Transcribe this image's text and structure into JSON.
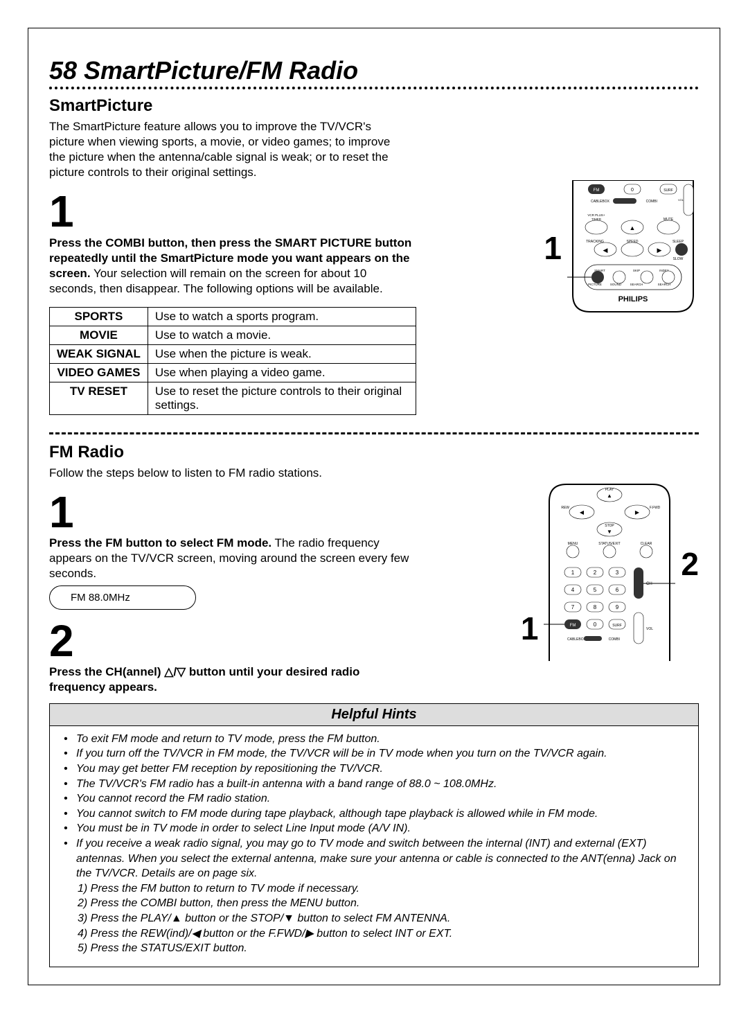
{
  "page_number": "58",
  "page_title": "SmartPicture/FM Radio",
  "smartpicture": {
    "heading": "SmartPicture",
    "intro": "The SmartPicture feature allows you to improve the TV/VCR's picture when viewing sports, a movie, or video games; to improve the picture when the antenna/cable signal is weak; or to reset the picture controls to their original settings.",
    "step1_num": "1",
    "step1_bold": "Press the COMBI button, then press the SMART PICTURE button repeatedly until the SmartPicture mode you want appears on the screen.",
    "step1_rest": " Your selection will remain on the screen for about 10 seconds, then disappear. The following options will be available.",
    "modes": [
      {
        "label": "SPORTS",
        "desc": "Use to watch a sports program."
      },
      {
        "label": "MOVIE",
        "desc": "Use to watch a movie."
      },
      {
        "label": "WEAK SIGNAL",
        "desc": "Use when the picture is weak."
      },
      {
        "label": "VIDEO GAMES",
        "desc": "Use when playing a video game."
      },
      {
        "label": "TV RESET",
        "desc": "Use to reset the picture controls to their original settings."
      }
    ],
    "callout1": "1",
    "remote_brand": "PHILIPS",
    "remote_buttons": {
      "fm": "FM",
      "zero": "0",
      "surf": "SURF",
      "cablebox": "CABLEBOX",
      "combi": "COMBI",
      "vcrplus": "VCR PLUS+",
      "timer": "TIMER",
      "tracking": "TRACKING",
      "speed": "SPEED",
      "mute": "MUTE",
      "slow": "SLOW",
      "sleep": "SLEEP",
      "smart": "SMART",
      "picture": "PICTURE",
      "sound": "SOUND",
      "skip": "SKIP",
      "search": "SEARCH",
      "index": "INDEX",
      "search2": "SEARCH",
      "vol": "VOL"
    }
  },
  "fmradio": {
    "heading": "FM Radio",
    "intro": "Follow the steps below to listen to FM radio stations.",
    "step1_num": "1",
    "step1_bold": "Press the FM button to select FM mode.",
    "step1_rest": " The radio frequency appears on the TV/VCR screen, moving around the screen every few seconds.",
    "freq_display": "FM  88.0MHz",
    "step2_num": "2",
    "step2_bold": "Press the CH(annel) △/▽ button until your desired radio frequency appears.",
    "callout1": "1",
    "callout2": "2",
    "remote_buttons": {
      "play": "PLAY",
      "rew": "REW",
      "ffwd": "F.FWD",
      "stop": "STOP",
      "menu": "MENU",
      "status": "STATUS/EXIT",
      "clear": "CLEAR",
      "n1": "1",
      "n2": "2",
      "n3": "3",
      "n4": "4",
      "n5": "5",
      "n6": "6",
      "n7": "7",
      "n8": "8",
      "n9": "9",
      "fm": "FM",
      "zero": "0",
      "surf": "SURF",
      "ch": "CH",
      "vol": "VOL",
      "cablebox": "CABLEBOX",
      "combi": "COMBI"
    }
  },
  "hints": {
    "title": "Helpful Hints",
    "items": [
      "To exit FM mode and return to TV mode, press the FM button.",
      "If you turn off the TV/VCR in FM mode, the TV/VCR will be in TV mode when you turn on the TV/VCR again.",
      "You may get better FM reception by repositioning the TV/VCR.",
      "The TV/VCR's FM radio has a built-in antenna with a band range of 88.0 ~ 108.0MHz.",
      "You cannot record the FM radio station.",
      "You cannot switch to FM mode during tape playback, although tape playback is allowed while in FM mode.",
      "You must be in TV mode in order to select Line Input mode (A/V IN).",
      "If you receive a weak radio signal, you may go to TV mode and switch between the internal (INT) and external (EXT) antennas. When you select the external antenna, make sure your antenna or cable is connected to the ANT(enna) Jack on the TV/VCR. Details are on page six."
    ],
    "substeps": [
      "1) Press the FM button to return to TV mode if necessary.",
      "2) Press the COMBI button, then press the MENU button.",
      "3) Press the PLAY/▲ button or the STOP/▼ button to select FM ANTENNA.",
      "4) Press the REW(ind)/◀ button or the F.FWD/▶ button to select INT or EXT.",
      "5) Press the STATUS/EXIT button."
    ]
  }
}
